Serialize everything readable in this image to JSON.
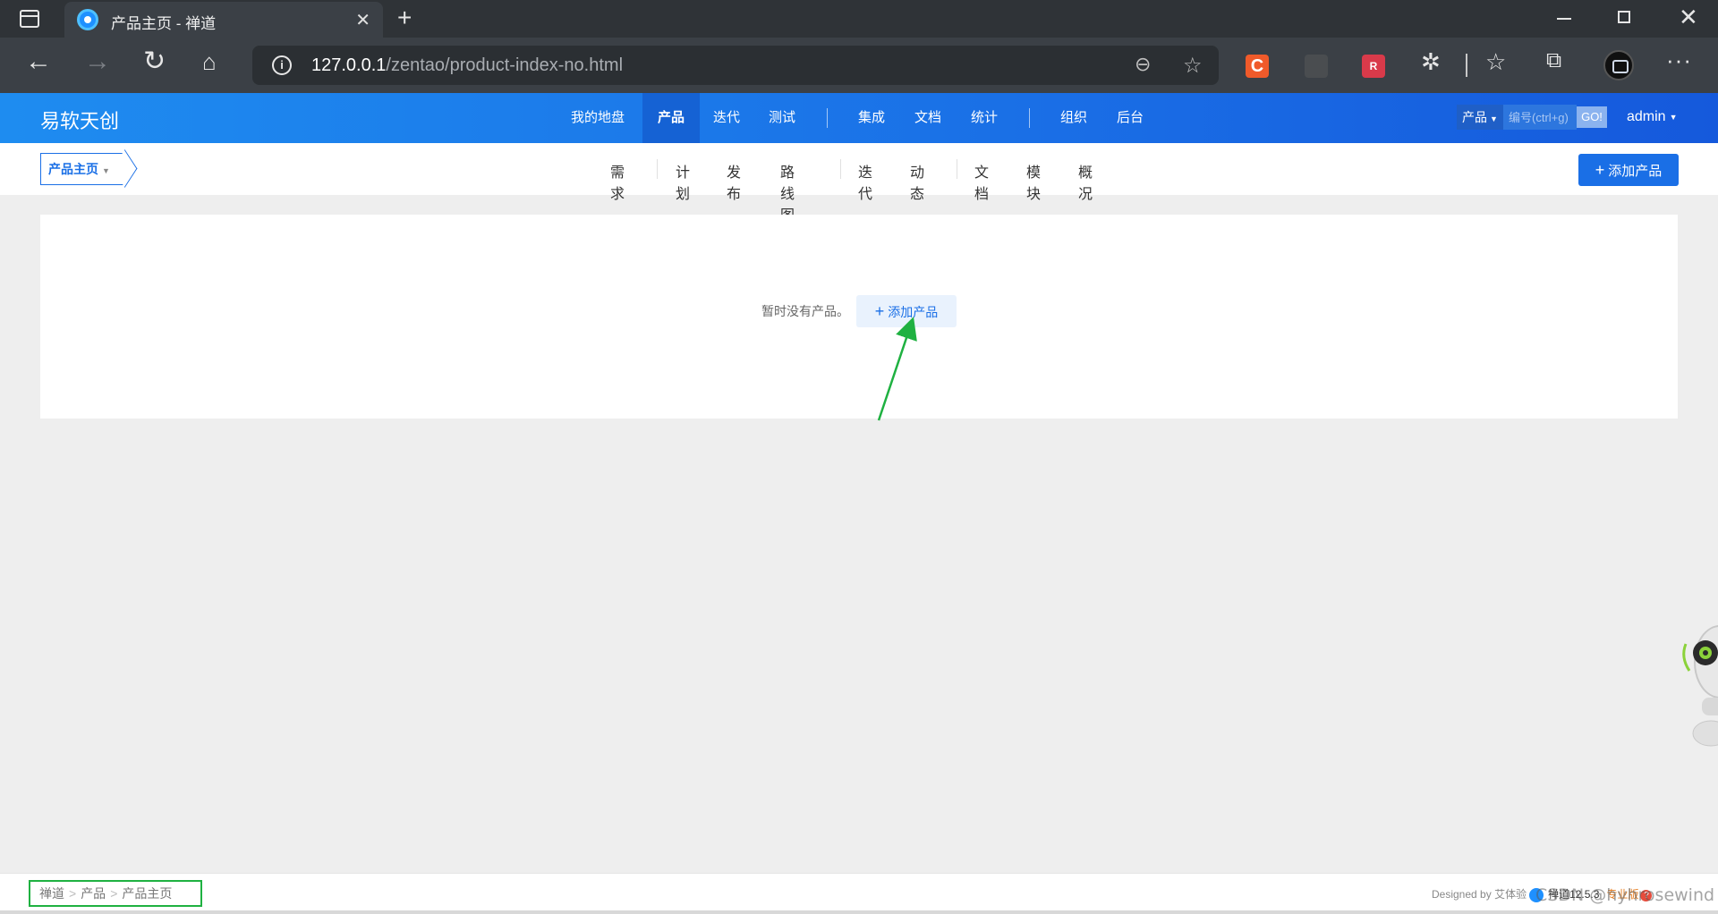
{
  "browser": {
    "tab_title": "产品主页 - 禅道",
    "url_host": "127.0.0.1",
    "url_path": "/zentao/product-index-no.html"
  },
  "header": {
    "brand": "易软天创",
    "nav": [
      {
        "label": "我的地盘"
      },
      {
        "label": "产品",
        "active": true
      },
      {
        "label": "迭代"
      },
      {
        "label": "测试"
      },
      {
        "label": "集成"
      },
      {
        "label": "文档"
      },
      {
        "label": "统计"
      },
      {
        "label": "组织"
      },
      {
        "label": "后台"
      }
    ],
    "search_type": "产品",
    "search_placeholder": "编号(ctrl+g)",
    "search_go": "GO!",
    "user": "admin"
  },
  "subnav": {
    "current": "产品主页",
    "items": [
      "需求",
      "计划",
      "发布",
      "路线图",
      "迭代",
      "动态",
      "文档",
      "模块",
      "概况"
    ],
    "add_button": "添加产品"
  },
  "main": {
    "empty_text": "暂时没有产品。",
    "empty_button": "添加产品"
  },
  "footer": {
    "breadcrumb": [
      "禅道",
      "产品",
      "产品主页"
    ],
    "designed_by": "Designed by",
    "designer": "艾体验",
    "version": "禅道12.5.3",
    "edition": "专业版"
  },
  "watermark": "CSDN @hyhrosewind",
  "colors": {
    "brand_blue": "#1a6fe6",
    "annotation_green": "#1fb141"
  }
}
